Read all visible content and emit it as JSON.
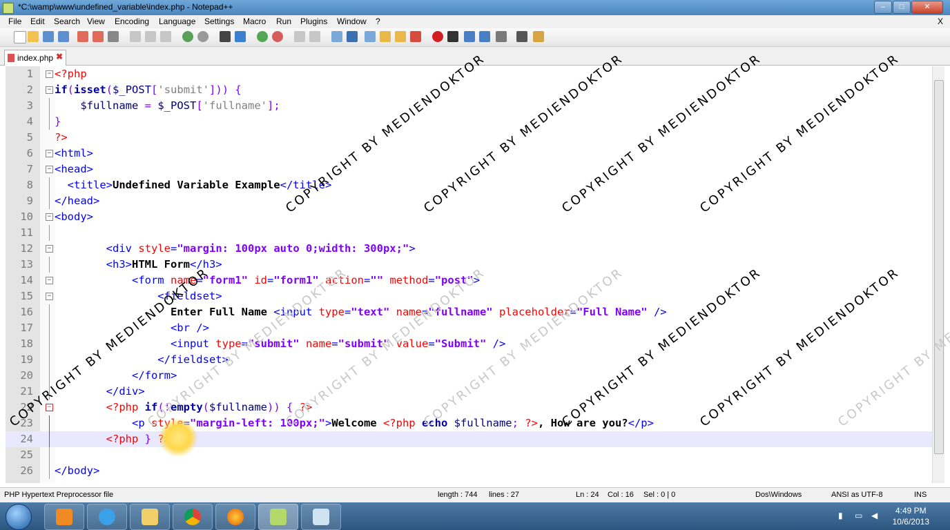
{
  "window": {
    "title": "*C:\\wamp\\www\\undefined_variable\\index.php - Notepad++",
    "minimize": "–",
    "maximize": "□",
    "close": "✕"
  },
  "menu": [
    "File",
    "Edit",
    "Search",
    "View",
    "Encoding",
    "Language",
    "Settings",
    "Macro",
    "Run",
    "Plugins",
    "Window",
    "?"
  ],
  "menu_close": "X",
  "tab": {
    "label": "index.php",
    "close": "✖"
  },
  "status": {
    "filetype": "PHP Hypertext Preprocessor file",
    "length": "length : 744",
    "lines": "lines : 27",
    "ln": "Ln : 24",
    "col": "Col : 16",
    "sel": "Sel : 0 | 0",
    "eol": "Dos\\Windows",
    "encoding": "ANSI as UTF-8",
    "mode": "INS"
  },
  "taskbar": {
    "time": "4:49 PM",
    "date": "10/6/2013"
  },
  "watermark": {
    "text": "COPYRIGHT BY MEDIENDOKTOR"
  },
  "code": {
    "l1": {
      "num": "1",
      "text": "<?php"
    },
    "l2": {
      "num": "2",
      "p1": "if",
      "p2": "(",
      "p3": "isset",
      "p4": "(",
      "p5": "$_POST",
      "p6": "[",
      "p7": "'submit'",
      "p8": "])) {"
    },
    "l3": {
      "num": "3",
      "p1": "    $fullname",
      "p2": " = ",
      "p3": "$_POST",
      "p4": "[",
      "p5": "'fullname'",
      "p6": "];"
    },
    "l4": {
      "num": "4",
      "text": "}"
    },
    "l5": {
      "num": "5",
      "text": "?>"
    },
    "l6": {
      "num": "6",
      "text": "<html>"
    },
    "l7": {
      "num": "7",
      "text": "<head>"
    },
    "l8": {
      "num": "8",
      "p1": "  <title>",
      "p2": "Undefined Variable Example",
      "p3": "</title>"
    },
    "l9": {
      "num": "9",
      "text": "</head>"
    },
    "l10": {
      "num": "10",
      "text": "<body>"
    },
    "l11": {
      "num": "11"
    },
    "l12": {
      "num": "12",
      "p1": "        <div ",
      "p2": "style",
      "p3": "=",
      "p4": "\"margin: 100px auto 0;width: 300px;\"",
      "p5": ">"
    },
    "l13": {
      "num": "13",
      "p1": "        <h3>",
      "p2": "HTML Form",
      "p3": "</h3>"
    },
    "l14": {
      "num": "14",
      "p1": "            <form ",
      "p2": "name",
      "p3": "=",
      "p4": "\"form1\"",
      "p5": " ",
      "p6": "id",
      "p7": "=",
      "p8": "\"form1\"",
      "p9": " ",
      "p10": "action",
      "p11": "=",
      "p12": "\"\"",
      "p13": " ",
      "p14": "method",
      "p15": "=",
      "p16": "\"post\"",
      "p17": ">"
    },
    "l15": {
      "num": "15",
      "p1": "                <fieldset>"
    },
    "l16": {
      "num": "16",
      "p1": "                  Enter Full Name ",
      "p2": "<input ",
      "p3": "type",
      "p4": "=",
      "p5": "\"text\"",
      "p6": " ",
      "p7": "name",
      "p8": "=",
      "p9": "\"fullname\"",
      "p10": " ",
      "p11": "placeholder",
      "p12": "=",
      "p13": "\"Full Name\"",
      "p14": " />"
    },
    "l17": {
      "num": "17",
      "p1": "                  <br />"
    },
    "l18": {
      "num": "18",
      "p1": "                  <input ",
      "p2": "type",
      "p3": "=",
      "p4": "\"submit\"",
      "p5": " ",
      "p6": "name",
      "p7": "=",
      "p8": "\"submit\"",
      "p9": " ",
      "p10": "value",
      "p11": "=",
      "p12": "\"Submit\"",
      "p13": " />"
    },
    "l19": {
      "num": "19",
      "p1": "                </fieldset>"
    },
    "l20": {
      "num": "20",
      "p1": "            </form>"
    },
    "l21": {
      "num": "21",
      "p1": "        </div>"
    },
    "l22": {
      "num": "22",
      "p1": "        <?php ",
      "p2": "if",
      "p3": "(!",
      "p4": "empty",
      "p5": "(",
      "p6": "$fullname",
      "p7": ")) { ",
      "p8": "?>"
    },
    "l23": {
      "num": "23",
      "p1": "            <p ",
      "p2": "style",
      "p3": "=",
      "p4": "\"margin-left: 100px;\"",
      "p5": ">",
      "p6": "Welcome ",
      "p7": "<?php ",
      "p8": "echo ",
      "p9": "$fullname",
      "p10": "; ",
      "p11": "?>",
      "p12": ", How are you?",
      "p13": "</p>"
    },
    "l24": {
      "num": "24",
      "p1": "        <?php ",
      "p2": "} ",
      "p3": "?>"
    },
    "l25": {
      "num": "25"
    },
    "l26": {
      "num": "26",
      "text": "</body>"
    }
  }
}
